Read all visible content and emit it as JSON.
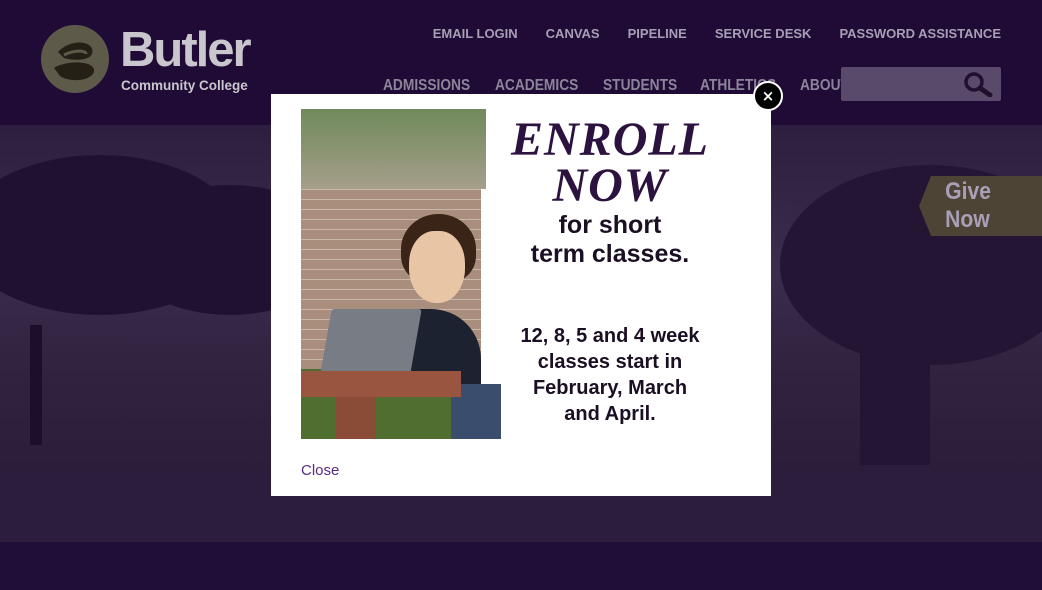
{
  "logo": {
    "name": "Butler",
    "tagline": "Community College"
  },
  "utility_nav": [
    "EMAIL LOGIN",
    "CANVAS",
    "PIPELINE",
    "SERVICE DESK",
    "PASSWORD ASSISTANCE"
  ],
  "main_nav": [
    "ADMISSIONS",
    "ACADEMICS",
    "STUDENTS",
    "ATHLETICS",
    "ABOUT"
  ],
  "search": {
    "placeholder": "",
    "icon": "magnifier-icon"
  },
  "give": {
    "label": "Give Now"
  },
  "modal": {
    "close_symbol": "×",
    "close_link": "Close",
    "promo": {
      "headline_1": "ENROLL",
      "headline_2": "NOW",
      "sub_1": "for short",
      "sub_2": "term classes.",
      "dates_1": "12, 8, 5 and 4 week",
      "dates_2": "classes start in",
      "dates_3": "February, March",
      "dates_4": "and April."
    }
  },
  "colors": {
    "header_bg": "#1f0b36",
    "accent": "#5a2b85",
    "modal_bg": "#ffffff"
  }
}
